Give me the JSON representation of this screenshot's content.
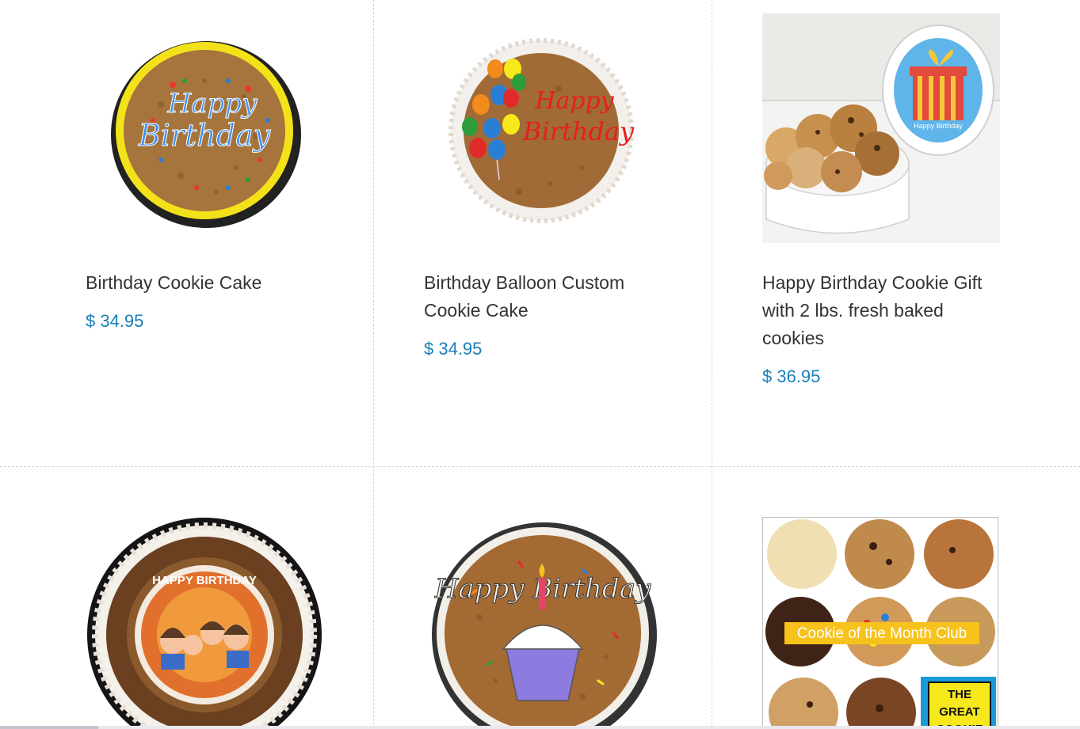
{
  "products": [
    {
      "title": "Birthday Cookie Cake",
      "price": "$ 34.95",
      "image_alt": "Birthday Cookie Cake"
    },
    {
      "title": "Birthday Balloon Custom Cookie Cake",
      "price": "$ 34.95",
      "image_alt": "Birthday Balloon Custom Cookie Cake"
    },
    {
      "title": "Happy Birthday Cookie Gift with 2 lbs. fresh baked cookies",
      "price": "$ 36.95",
      "image_alt": "Happy Birthday Cookie Gift"
    },
    {
      "title": "",
      "price": "",
      "image_alt": "Photo Birthday Cookie Cake",
      "cake_text": "HAPPY BIRTHDAY"
    },
    {
      "title": "",
      "price": "",
      "image_alt": "Happy Birthday Cupcake Cookie Cake",
      "cake_text": "Happy Birthday"
    },
    {
      "title": "",
      "price": "",
      "image_alt": "Cookie of the Month Club",
      "banner_text": "Cookie of the Month Club",
      "logo_text": [
        "THE",
        "GREAT",
        "COOKIE"
      ]
    }
  ],
  "artwork_text": {
    "cake1": [
      "Happy",
      "Birthday"
    ],
    "cake2": [
      "Happy",
      "Birthday"
    ],
    "tin_label": "Happy Birthday"
  },
  "colors": {
    "price": "#1a7fb8",
    "title": "#333333",
    "divider": "#d6d6d6"
  }
}
